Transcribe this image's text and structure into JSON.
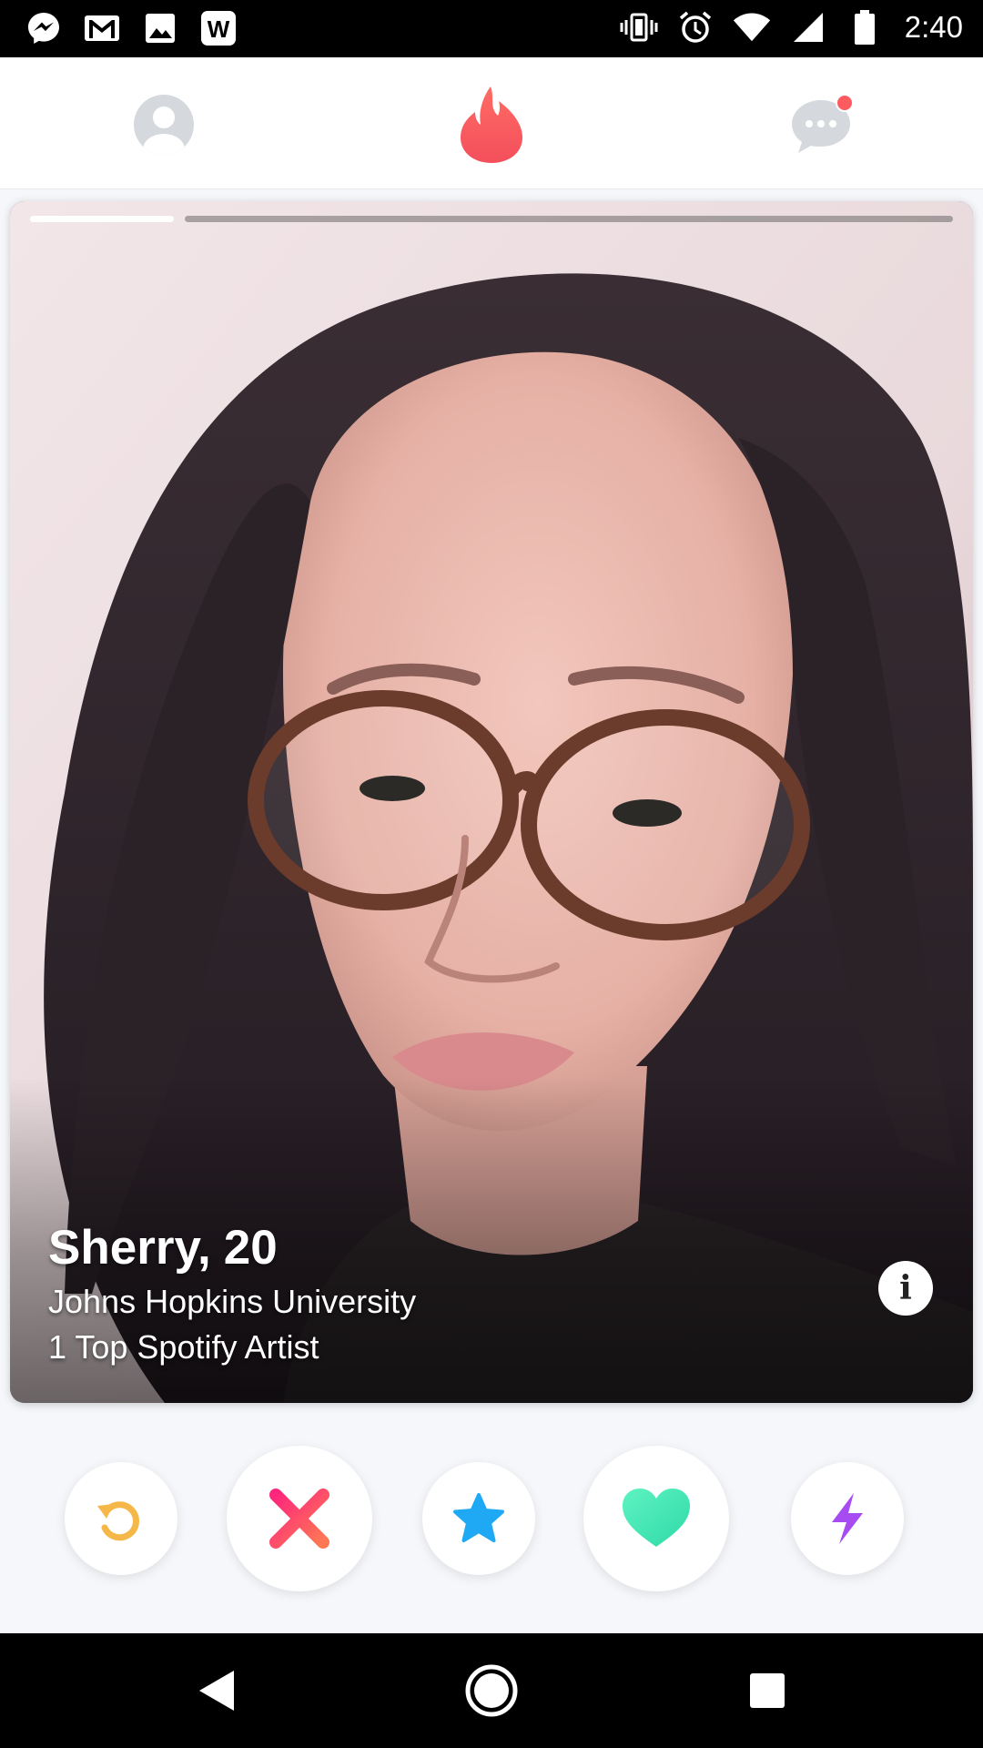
{
  "status_bar": {
    "time": "2:40",
    "left_icons": [
      "messenger-icon",
      "gmail-icon",
      "photos-icon",
      "word-icon"
    ],
    "word_letter": "W",
    "right_icons": [
      "vibrate-icon",
      "alarm-icon",
      "wifi-icon",
      "signal-icon",
      "battery-icon"
    ]
  },
  "top_bar": {
    "profile_icon": "profile-icon",
    "logo_icon": "flame-icon",
    "messages_icon": "messages-icon",
    "has_new_message": true,
    "accent_color": "#fd5b60"
  },
  "card": {
    "photo_count": 2,
    "current_photo": 1,
    "name": "Sherry,",
    "age": "20",
    "school": "Johns Hopkins University",
    "spotify": "1 Top Spotify Artist",
    "info_label": "i"
  },
  "actions": [
    {
      "name": "rewind",
      "icon": "rewind-icon",
      "color": "#f5b748"
    },
    {
      "name": "nope",
      "icon": "nope-x-icon",
      "color": "#fd5068"
    },
    {
      "name": "super-like",
      "icon": "star-icon",
      "color": "#1fa9f4"
    },
    {
      "name": "like",
      "icon": "heart-icon",
      "color": "#3ce7b1"
    },
    {
      "name": "boost",
      "icon": "lightning-icon",
      "color": "#a74cf2"
    }
  ],
  "nav_bar": {
    "icons": [
      "back-icon",
      "home-icon",
      "recents-icon"
    ]
  }
}
